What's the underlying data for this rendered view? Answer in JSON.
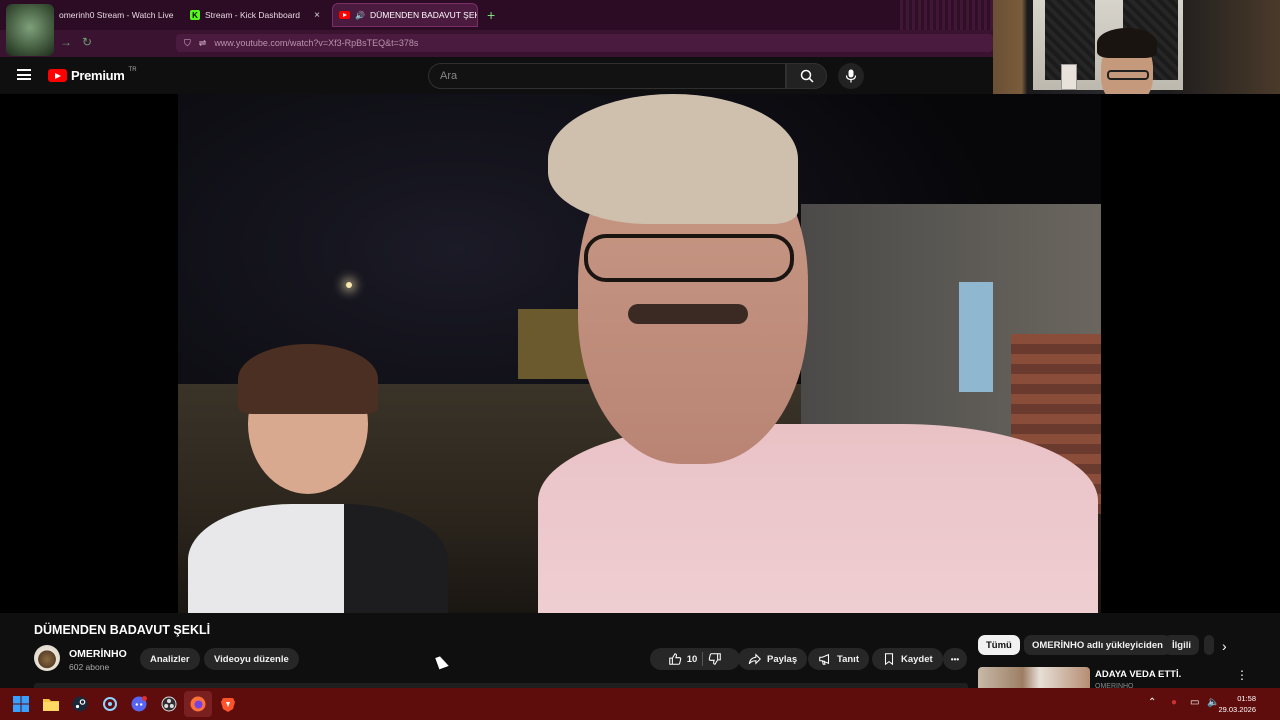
{
  "browser": {
    "tabs": [
      {
        "label": "omerinh0 Stream - Watch Live o",
        "close": "×"
      },
      {
        "label": "Stream - Kick Dashboard",
        "close": "×"
      },
      {
        "label": "DÜMENDEN BADAVUT ŞEKL",
        "close": "×"
      }
    ],
    "new_tab": "+",
    "url": "www.youtube.com/watch?v=Xf3-RpBsTEQ&t=378s",
    "back_icon": "arrow-left-icon",
    "forward_icon": "arrow-right-icon",
    "reload_icon": "reload-icon"
  },
  "youtube": {
    "brand": "Premium",
    "region": "TR",
    "search_placeholder": "Ara"
  },
  "video": {
    "title": "DÜMENDEN BADAVUT ŞEKLİ",
    "channel_name": "OMERİNHO",
    "subscribers": "602 abone",
    "analytics_label": "Analizler",
    "edit_label": "Videoyu düzenle",
    "like_count": "10",
    "share_label": "Paylaş",
    "promote_label": "Tanıt",
    "save_label": "Kaydet",
    "more_label": "•••"
  },
  "sidebar": {
    "chips": [
      "Tümü",
      "OMERİNHO adlı yükleyiciden",
      "İlgili"
    ],
    "recommendation": {
      "title": "ADAYA VEDA ETTİ.",
      "channel": "OMERİNHO"
    }
  },
  "taskbar": {
    "time": "01:58",
    "date": "29.03.2026",
    "accent": "#5e0c0c"
  }
}
